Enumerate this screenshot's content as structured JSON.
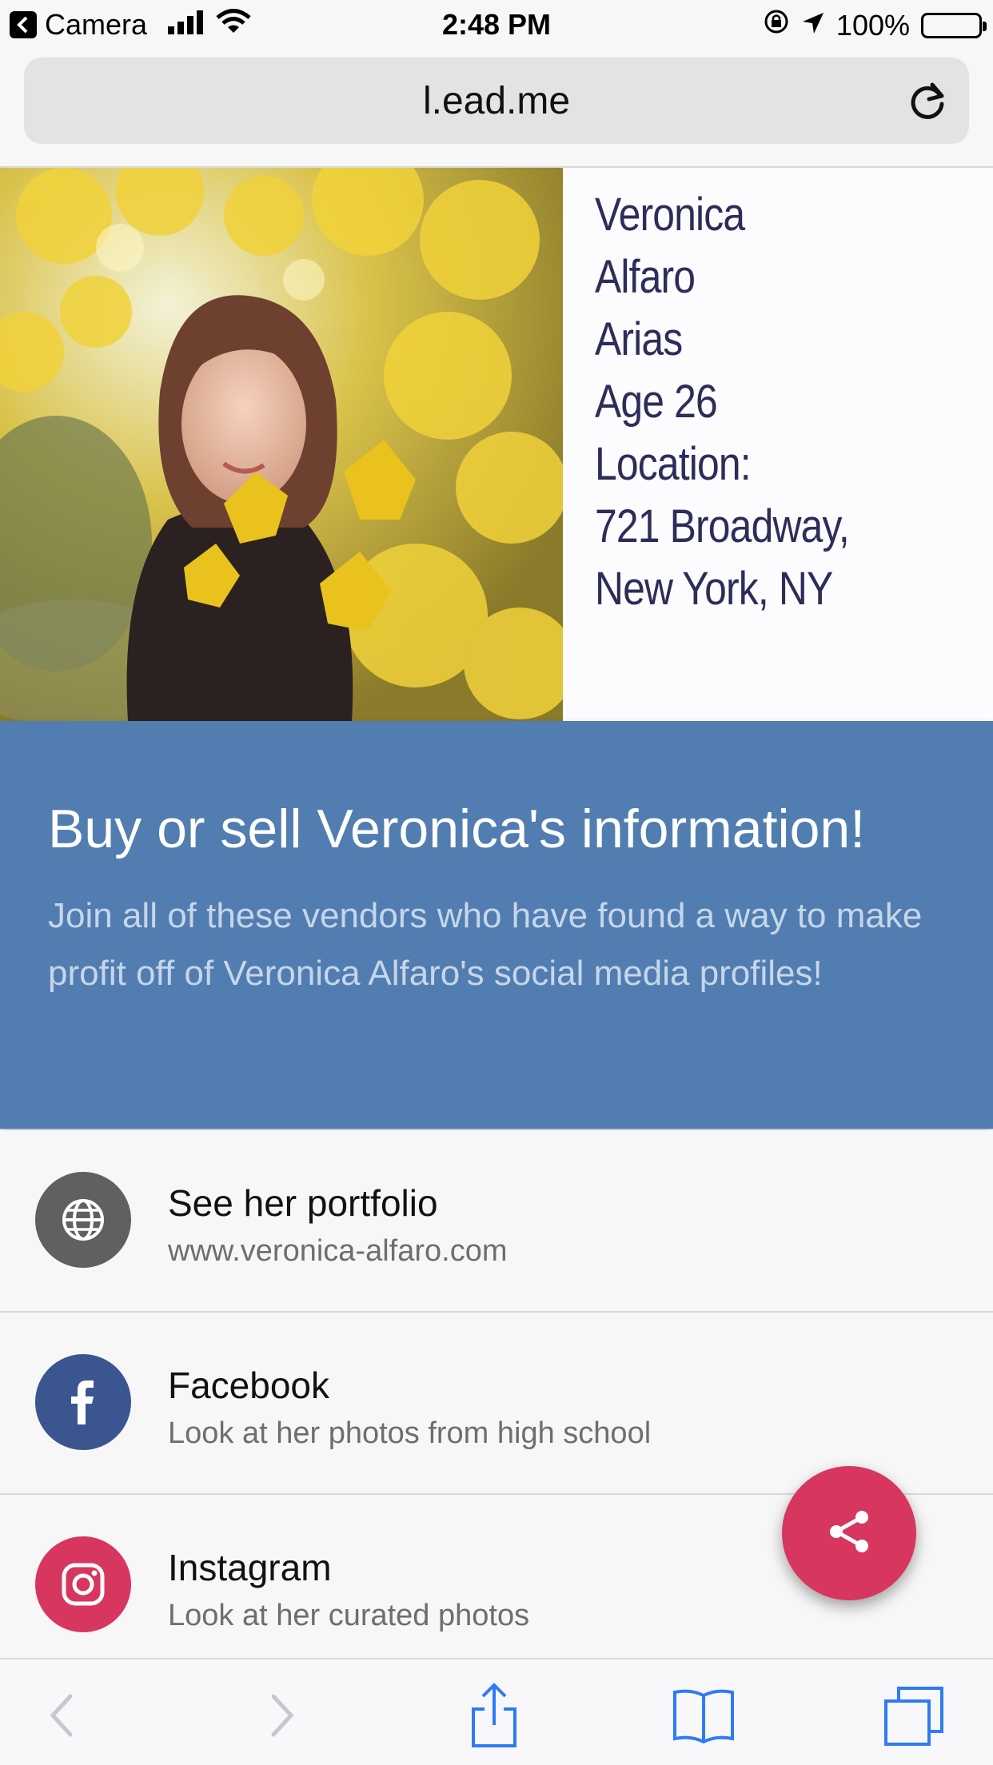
{
  "status_bar": {
    "back_app_label": "Camera",
    "time": "2:48 PM",
    "battery": "100%"
  },
  "browser": {
    "url": "l.ead.me"
  },
  "profile": {
    "lines": [
      "Veronica",
      "Alfaro",
      "Arias",
      "Age 26",
      "Location:",
      "721 Broadway,",
      "New York, NY"
    ]
  },
  "banner": {
    "title": "Buy or sell Veronica's information!",
    "subtitle": "Join all of these vendors who have found a way to make profit off of Veronica Alfaro's social media profiles!"
  },
  "links": [
    {
      "title": "See her portfolio",
      "subtitle": "www.veronica-alfaro.com",
      "icon": "globe-icon",
      "color": "#5f6062"
    },
    {
      "title": "Facebook",
      "subtitle": "Look at her photos from high school",
      "icon": "facebook-icon",
      "color": "#3b5591"
    },
    {
      "title": "Instagram",
      "subtitle": "Look at her curated photos",
      "icon": "instagram-icon",
      "color": "#d7365f"
    }
  ],
  "fab": {
    "icon": "share-icon",
    "color": "#d7365f"
  },
  "toolbar": {
    "icons": [
      "back-arrow-icon",
      "forward-arrow-icon",
      "share-icon",
      "bookmarks-icon",
      "tabs-icon"
    ],
    "accent": "#2f7bf5"
  }
}
